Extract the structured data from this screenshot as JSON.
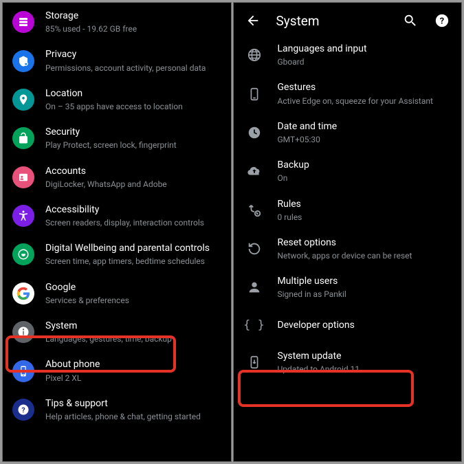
{
  "left": {
    "items": [
      {
        "label": "Storage",
        "sub": "85% used - 19.62 GB free",
        "icon": "storage-icon",
        "bg": "#b805d6"
      },
      {
        "label": "Privacy",
        "sub": "Permissions, account activity, personal data",
        "icon": "privacy-icon",
        "bg": "#1a73e8"
      },
      {
        "label": "Location",
        "sub": "On – 35 apps have access to location",
        "icon": "location-icon",
        "bg": "#009796"
      },
      {
        "label": "Security",
        "sub": "Play Protect, screen lock, fingerprint",
        "icon": "security-icon",
        "bg": "#01a35b"
      },
      {
        "label": "Accounts",
        "sub": "DigiLocker, WhatsApp and Adobe",
        "icon": "accounts-icon",
        "bg": "#e8517a"
      },
      {
        "label": "Accessibility",
        "sub": "Screen readers, display, interaction controls",
        "icon": "accessibility-icon",
        "bg": "#7b1fe6"
      },
      {
        "label": "Digital Wellbeing and parental controls",
        "sub": "Screen time, app timers, bedtime schedules",
        "icon": "wellbeing-icon",
        "bg": "#01a35b"
      },
      {
        "label": "Google",
        "sub": "Services & preferences",
        "icon": "google-icon",
        "bg": "#ffffff"
      },
      {
        "label": "System",
        "sub": "Languages, gestures, time, backup",
        "icon": "system-icon",
        "bg": "#5f6368"
      },
      {
        "label": "About phone",
        "sub": "Pixel 2 XL",
        "icon": "about-icon",
        "bg": "#3369e8"
      },
      {
        "label": "Tips & support",
        "sub": "Help articles, phone & chat, getting started",
        "icon": "help-icon",
        "bg": "#1a2e8c"
      }
    ]
  },
  "right": {
    "title": "System",
    "items": [
      {
        "label": "Languages and input",
        "sub": "Gboard",
        "icon": "language-icon"
      },
      {
        "label": "Gestures",
        "sub": "Active Edge on, squeeze for your Assistant",
        "icon": "gesture-icon"
      },
      {
        "label": "Date and time",
        "sub": "GMT+05:30",
        "icon": "clock-icon"
      },
      {
        "label": "Backup",
        "sub": "On",
        "icon": "backup-icon"
      },
      {
        "label": "Rules",
        "sub": "0 rules",
        "icon": "rules-icon"
      },
      {
        "label": "Reset options",
        "sub": "Network, apps or device can be reset",
        "icon": "reset-icon"
      },
      {
        "label": "Multiple users",
        "sub": "Signed in as Pankil",
        "icon": "users-icon"
      },
      {
        "label": "Developer options",
        "sub": "",
        "icon": "dev-icon"
      },
      {
        "label": "System update",
        "sub": "Updated to Android 11",
        "icon": "update-icon"
      }
    ]
  }
}
